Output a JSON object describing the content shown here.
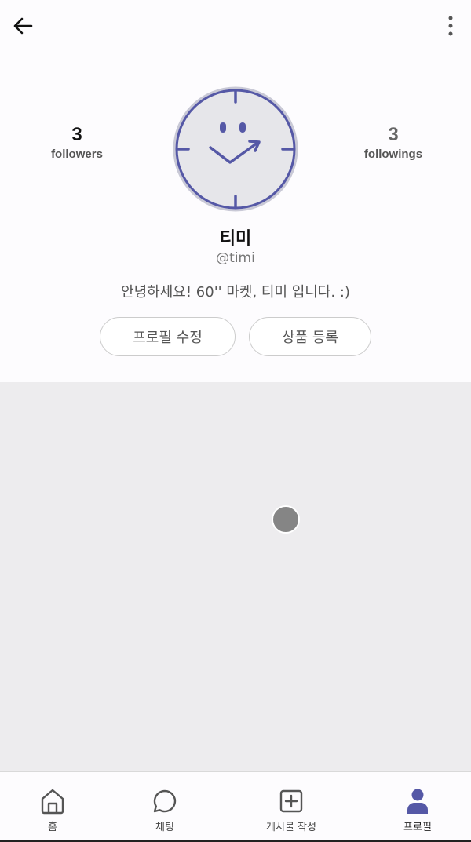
{
  "header": {
    "back_icon": "arrow-left-icon",
    "more_icon": "more-vertical-icon"
  },
  "profile": {
    "followers_count": "3",
    "followers_label": "followers",
    "followings_count": "3",
    "followings_label": "followings",
    "name": "티미",
    "handle": "@timi",
    "bio": "안녕하세요! 60'' 마켓, 티미 입니다. :)",
    "edit_button": "프로필 수정",
    "add_product_button": "상품 등록",
    "accent_color": "#5558a6"
  },
  "content": {
    "loading_indicator": "loading-spinner"
  },
  "tabbar": {
    "items": [
      {
        "label": "홈",
        "icon": "home-icon"
      },
      {
        "label": "채팅",
        "icon": "chat-icon"
      },
      {
        "label": "게시물 작성",
        "icon": "plus-square-icon"
      },
      {
        "label": "프로필",
        "icon": "user-icon",
        "active": true
      }
    ],
    "active_color": "#5558a6"
  }
}
